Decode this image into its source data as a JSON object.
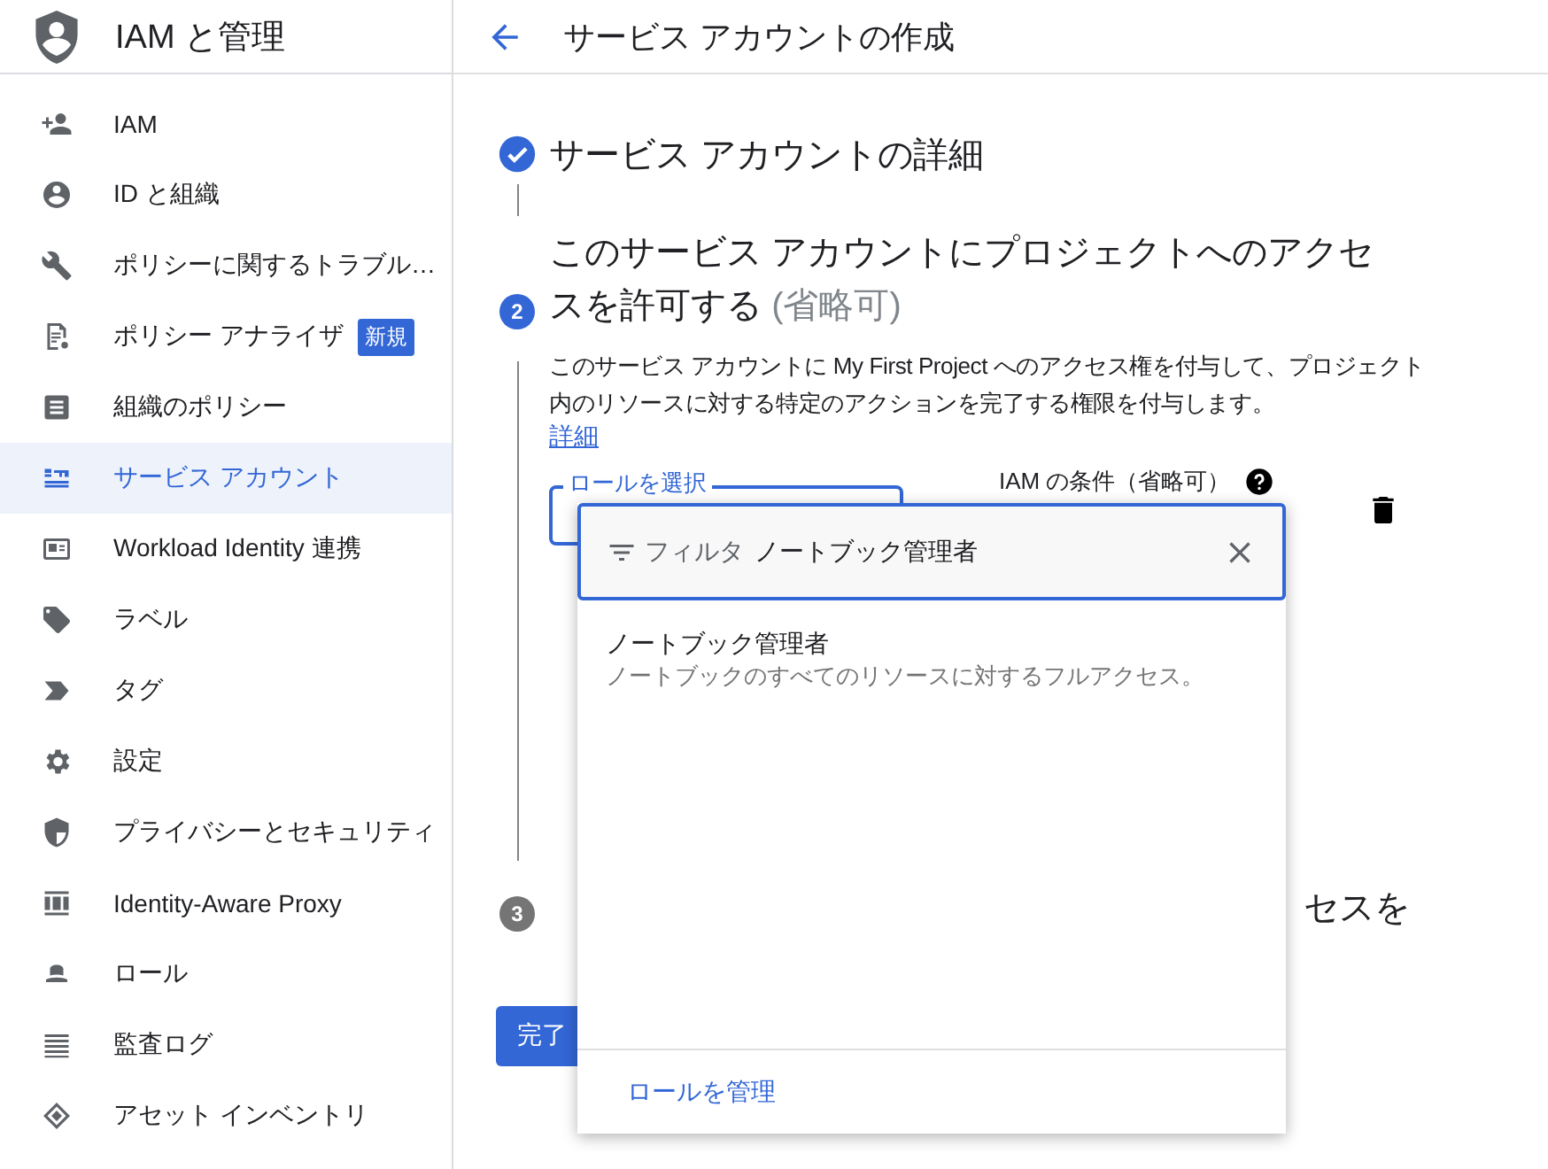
{
  "header": {
    "title": "IAM と管理"
  },
  "sidebar": {
    "items": [
      {
        "label": "IAM",
        "selected": false
      },
      {
        "label": "ID と組織",
        "selected": false
      },
      {
        "label": "ポリシーに関するトラブル…",
        "selected": false
      },
      {
        "label": "ポリシー アナライザ",
        "badge": "新規",
        "selected": false
      },
      {
        "label": "組織のポリシー",
        "selected": false
      },
      {
        "label": "サービス アカウント",
        "selected": true
      },
      {
        "label": "Workload Identity 連携",
        "selected": false
      },
      {
        "label": "ラベル",
        "selected": false
      },
      {
        "label": "タグ",
        "selected": false
      },
      {
        "label": "設定",
        "selected": false
      },
      {
        "label": "プライバシーとセキュリティ",
        "selected": false
      },
      {
        "label": "Identity-Aware Proxy",
        "selected": false
      },
      {
        "label": "ロール",
        "selected": false
      },
      {
        "label": "監査ログ",
        "selected": false
      },
      {
        "label": "アセット インベントリ",
        "selected": false
      }
    ]
  },
  "topbar": {
    "title": "サービス アカウントの作成"
  },
  "steps": [
    {
      "kind": "done",
      "title": "サービス アカウントの詳細"
    },
    {
      "kind": "current",
      "number": "2",
      "title": "このサービス アカウントにプロジェクトへのアクセスを許可する",
      "optional": "(省略可)",
      "description": "このサービス アカウントに My First Project へのアクセス権を付与して、プロジェクト内のリソースに対する特定のアクションを完了する権限を付与します。",
      "link": "詳細"
    },
    {
      "kind": "pending",
      "number": "3",
      "title_visible": "セスを"
    }
  ],
  "role_field": {
    "label": "ロールを選択"
  },
  "condition": {
    "label": "IAM の条件（省略可）"
  },
  "done_button": "完了",
  "dropdown": {
    "filter_label": "フィルタ",
    "filter_value": "ノートブック管理者",
    "results": [
      {
        "title": "ノートブック管理者",
        "description": "ノートブックのすべてのリソースに対するフルアクセス。"
      }
    ],
    "footer_link": "ロールを管理"
  }
}
